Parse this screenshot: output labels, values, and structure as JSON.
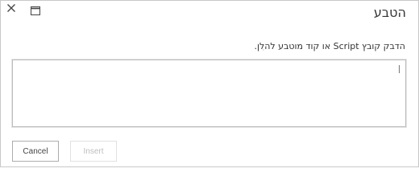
{
  "dialog": {
    "title": "הטבע",
    "instruction": "הדבק קובץ Script או קוד מוטבע להלן.",
    "code_input": {
      "value": "",
      "placeholder": ""
    },
    "buttons": {
      "insert": "Insert",
      "cancel": "Cancel"
    },
    "icons": {
      "close": "close-icon",
      "maximize": "maximize-icon"
    }
  },
  "colors": {
    "border": "#c8c8c8",
    "text": "#333333",
    "disabled_text": "#bdbdbd"
  }
}
